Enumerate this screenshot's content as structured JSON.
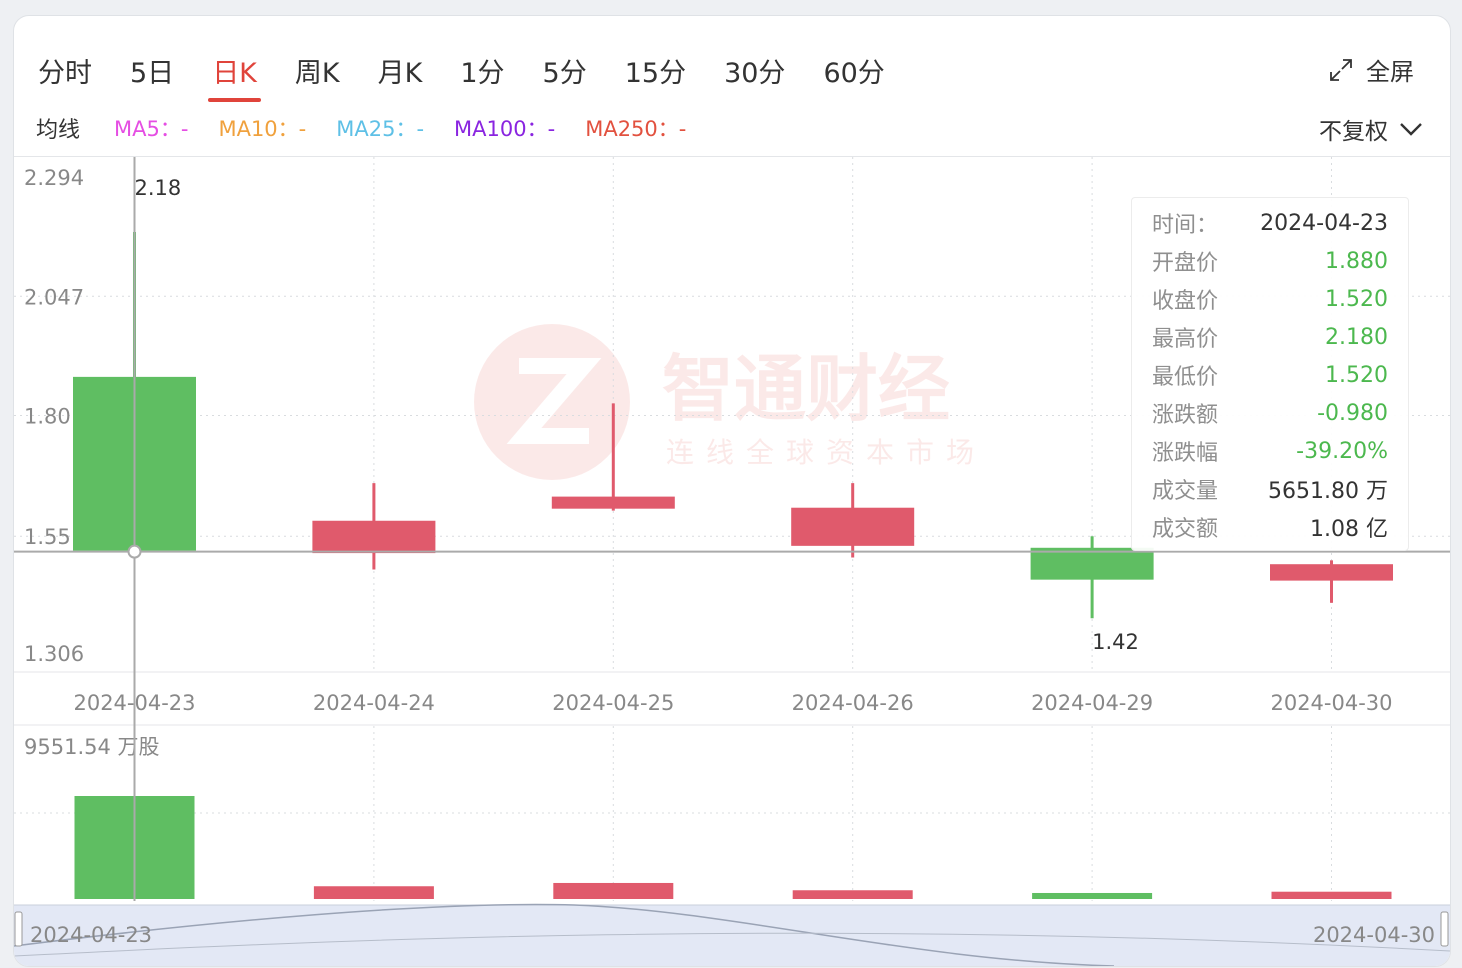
{
  "tabs": [
    {
      "label": "分时",
      "active": false
    },
    {
      "label": "5日",
      "active": false
    },
    {
      "label": "日K",
      "active": true
    },
    {
      "label": "周K",
      "active": false
    },
    {
      "label": "月K",
      "active": false
    },
    {
      "label": "1分",
      "active": false
    },
    {
      "label": "5分",
      "active": false
    },
    {
      "label": "15分",
      "active": false
    },
    {
      "label": "30分",
      "active": false
    },
    {
      "label": "60分",
      "active": false
    }
  ],
  "fullscreen_label": "全屏",
  "ma_label": "均线",
  "ma_items": [
    {
      "text": "MA5：-",
      "color": "#e54ee3"
    },
    {
      "text": "MA10：-",
      "color": "#f0a13d"
    },
    {
      "text": "MA25：-",
      "color": "#5ec0e6"
    },
    {
      "text": "MA100：-",
      "color": "#8a25e0"
    },
    {
      "text": "MA250：-",
      "color": "#e2513f"
    }
  ],
  "adjust_label": "不复权",
  "watermark": {
    "title": "智通财经",
    "subtitle": "连线全球资本市场"
  },
  "tooltip": {
    "rows": [
      {
        "key": "时间：",
        "value": "2024-04-23",
        "tone": "normal"
      },
      {
        "key": "开盘价",
        "value": "1.880",
        "tone": "green"
      },
      {
        "key": "收盘价",
        "value": "1.520",
        "tone": "green"
      },
      {
        "key": "最高价",
        "value": "2.180",
        "tone": "green"
      },
      {
        "key": "最低价",
        "value": "1.520",
        "tone": "green"
      },
      {
        "key": "涨跌额",
        "value": "-0.980",
        "tone": "green"
      },
      {
        "key": "涨跌幅",
        "value": "-39.20%",
        "tone": "green"
      },
      {
        "key": "成交量",
        "value": "5651.80 万",
        "tone": "normal"
      },
      {
        "key": "成交额",
        "value": "1.08 亿",
        "tone": "normal"
      }
    ]
  },
  "chart_data": {
    "type": "candlestick",
    "categories": [
      "2024-04-23",
      "2024-04-24",
      "2024-04-25",
      "2024-04-26",
      "2024-04-29",
      "2024-04-30"
    ],
    "price_ticks": [
      "2.294",
      "2.047",
      "1.80",
      "1.55",
      "1.306"
    ],
    "ylim": [
      1.306,
      2.294
    ],
    "candles": [
      {
        "open": 1.88,
        "close": 1.52,
        "high": 2.18,
        "low": 1.52
      },
      {
        "open": 1.515,
        "close": 1.582,
        "high": 1.66,
        "low": 1.481
      },
      {
        "open": 1.607,
        "close": 1.632,
        "high": 1.825,
        "low": 1.603
      },
      {
        "open": 1.53,
        "close": 1.609,
        "high": 1.66,
        "low": 1.506
      },
      {
        "open": 1.526,
        "close": 1.46,
        "high": 1.55,
        "low": 1.38
      },
      {
        "open": 1.458,
        "close": 1.492,
        "high": 1.5,
        "low": 1.412
      }
    ],
    "high_label": "2.18",
    "low_label": "1.42",
    "crosshair_price": 1.518,
    "up_color": "#e05a6c",
    "down_color": "#5fbe62",
    "volume_label": "9551.54 万股",
    "volume_max": 9551.54,
    "volumes": [
      5651.8,
      700,
      880,
      480,
      330,
      400
    ],
    "navigator": {
      "start": "2024-04-23",
      "end": "2024-04-30"
    }
  }
}
